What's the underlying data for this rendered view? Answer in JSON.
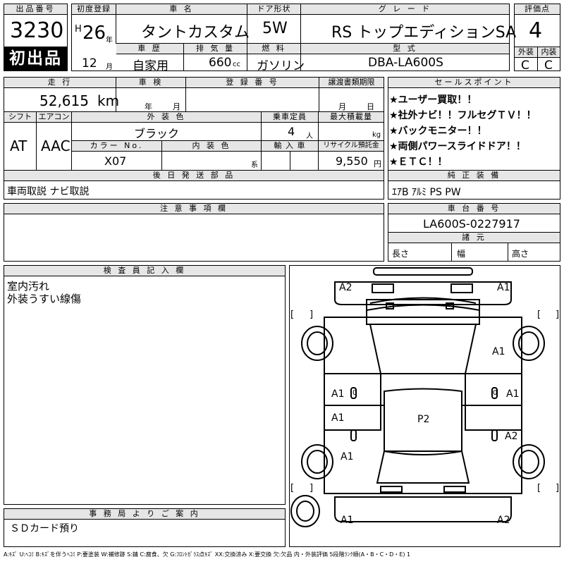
{
  "auction": {
    "lot_no_label": "出品番号",
    "lot_no": "3230",
    "first_listing_badge": "初出品",
    "first_reg_label": "初度登録",
    "first_reg_era": "H",
    "first_reg_year": "26",
    "year_suffix": "年",
    "month_suffix": "月",
    "first_reg_month": "12",
    "car_name_label": "車 名",
    "car_name": "タントカスタム",
    "door_label": "ドア形状",
    "door": "5W",
    "grade_label": "グ レ ー ド",
    "grade": "RS トップエディションSA",
    "score_label": "評価点",
    "score": "4",
    "history_label": "車 歴",
    "history": "自家用",
    "displacement_label": "排 気 量",
    "displacement": "660",
    "displacement_unit": "cc",
    "fuel_label": "燃 料",
    "fuel": "ガソリン",
    "model_label": "型 式",
    "model": "DBA-LA600S",
    "exterior_label": "外装",
    "interior_label": "内装",
    "exterior_grade": "C",
    "interior_grade": "C"
  },
  "specs": {
    "mileage_label": "走 行",
    "mileage": "52,615",
    "mileage_unit": "km",
    "inspection_label": "車 検",
    "inspection_year": "年",
    "inspection_month": "月",
    "reg_no_label": "登 録 番 号",
    "transfer_label": "譲渡書類期限",
    "transfer_month": "月",
    "transfer_day": "日",
    "shift_label": "シフト",
    "shift": "AT",
    "ac_label": "エアコン",
    "ac": "AAC",
    "ext_color_label": "外 装 色",
    "ext_color": "ブラック",
    "color_no_label": "カラー No.",
    "color_no": "X07",
    "int_color_label": "内 装 色",
    "int_color_suffix": "系",
    "capacity_label": "乗車定員",
    "capacity": "4",
    "capacity_unit": "人",
    "import_label": "輸 入 車",
    "max_load_label": "最大積載量",
    "max_load_unit": "kg",
    "recycle_label": "リサイクル預託金",
    "recycle": "9,550",
    "recycle_unit": "円",
    "later_parts_label": "後 日 発 送 部 品",
    "later_parts": "車両取説 ナビ取説"
  },
  "sales_points": {
    "label": "セールスポイント",
    "items": [
      "★ユーザー買取！！",
      "★社外ナビ！！フルセグＴＶ！！",
      "★バックモニター！！",
      "★両側パワースライドドア！！",
      "★ＥＴＣ！！"
    ]
  },
  "equipment": {
    "label": "純 正 装 備",
    "value": "ｴｱB ｱﾙﾐ PS PW"
  },
  "chassis": {
    "label": "車 台 番 号",
    "value": "LA600S-0227917",
    "dims_label": "諸 元",
    "length_label": "長さ",
    "width_label": "幅",
    "height_label": "高さ"
  },
  "notes": {
    "label": "注 意 事 項 欄"
  },
  "inspector": {
    "label": "検 査 員 記 入 欄",
    "line1": "室内汚れ",
    "line2": "外装うすい線傷"
  },
  "office": {
    "label": "事 務 局 よ り ご 案 内",
    "text": "ＳＤカード預り"
  },
  "diagram": {
    "marks": {
      "front_left": "A2",
      "front_right": "A1",
      "front_fender_right": "A1",
      "door_fl": "A1",
      "door_fr": "A1",
      "door_rl": "A1",
      "door_rr": "A2",
      "roof": "P2",
      "rear_fender_left": "A1",
      "rear_left": "A1",
      "rear_right": "A2"
    },
    "bracket_open": "[",
    "bracket_close": "]",
    "zero": "0"
  },
  "legend": "A:ｷｽﾞ U:ﾍｺﾐ B:ｷｽﾞを伴うﾍｺﾐ P:要塗装 W:補修跡 S:錆 C:腐食、欠 G:ﾌﾛﾝﾄｶﾞﾗｽ点ｷｽﾞ XX:交換済み X:要交換 欠:欠品 内・外装評価 5段階ﾗﾝｸ順(A・B・C・D・E) 1"
}
